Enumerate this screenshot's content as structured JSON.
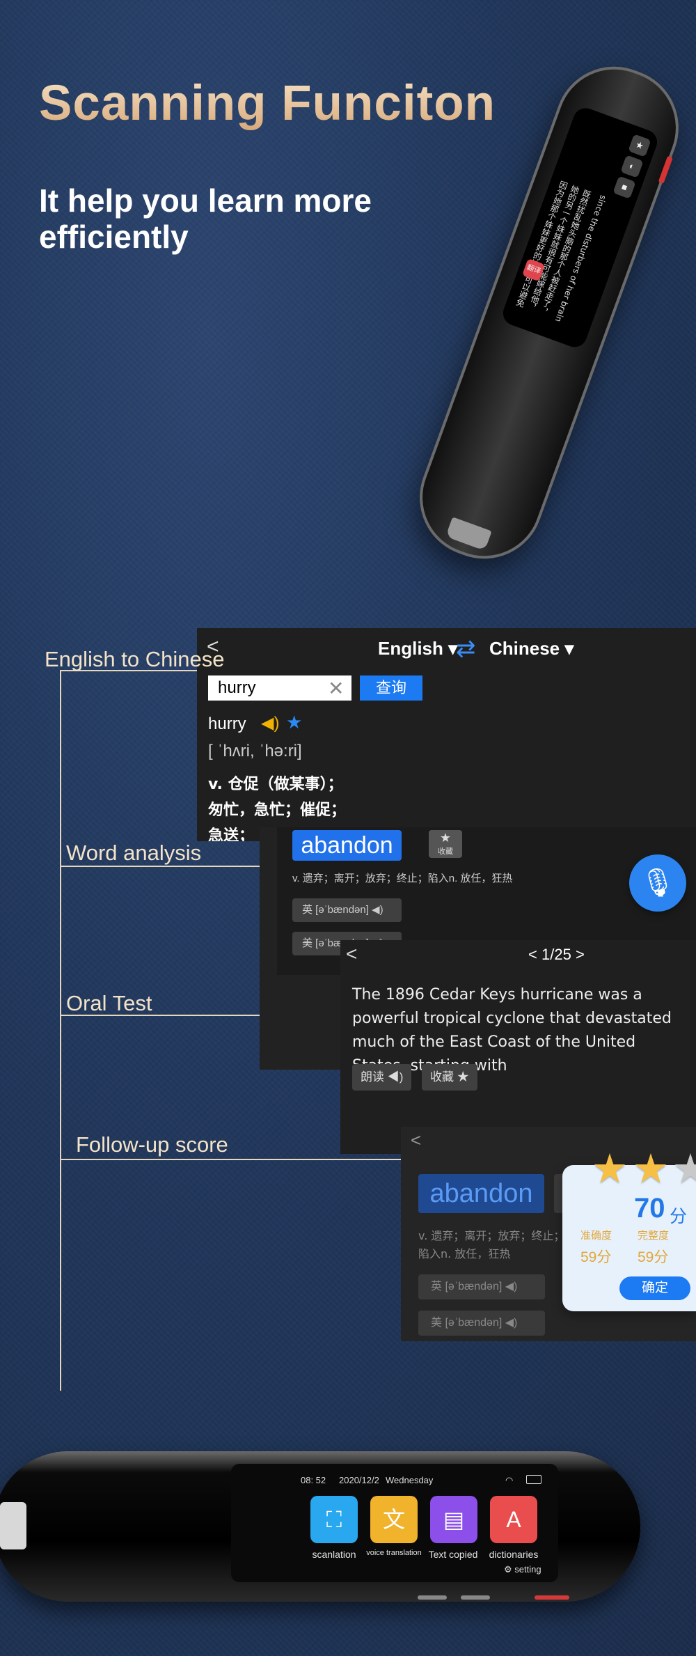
{
  "hero": {
    "title": "Scanning Funciton",
    "subtitle": "It help you learn more efficiently"
  },
  "pen_top": {
    "buttons": [
      "★",
      "◐",
      "■"
    ],
    "text_en": "since the disturbers of her brain",
    "text_cn": "既然扰乱她头脑的那个人被赶走了，她的另一个妹妹就很有可能嫁给他，因为她那个妹妹更好的妹妹可以避免的",
    "red_btn_label": "翻译"
  },
  "labels": {
    "english_to_chinese": "English to Chinese",
    "word_analysis": "Word analysis",
    "oral_test": "Oral Test",
    "follow_up_score": "Follow-up score"
  },
  "panel_translate": {
    "back": "<",
    "lang_from": "English",
    "lang_to": "Chinese",
    "search_value": "hurry",
    "query_button": "查询",
    "word": "hurry",
    "phonetic": "[ ˈhʌri, ˈhə:ri]",
    "definitions": [
      "v. 仓促（做某事）；",
      "匆忙，急忙；催促；",
      "急送；"
    ]
  },
  "panel_word": {
    "word": "abandon",
    "fav_label": "收藏",
    "meaning": "v. 遗弃；离开；放弃；终止；陷入n. 放任，狂热",
    "pron_uk": "英 [əˈbændən]",
    "pron_us": "美 [əˈbændən]"
  },
  "panel_oral": {
    "back": "<",
    "pager": "1/25",
    "paragraph": "The 1896 Cedar Keys hurricane was a powerful tropical cyclone that devastated much of the East Coast of the United States, starting with",
    "read_button": "朗读",
    "fav_button": "收藏"
  },
  "panel_follow": {
    "back": "<",
    "word": "abandon",
    "meaning": "v. 遗弃；离开；放弃；终止；陷入n. 放任，狂热",
    "pron_uk": "英 [əˈbændən]",
    "pron_us": "美 [əˈbændən]"
  },
  "score": {
    "value": "70",
    "unit": "分",
    "accuracy_label": "准确度",
    "accuracy_value": "59分",
    "completeness_label": "完整度",
    "completeness_value": "59分",
    "confirm_button": "确定",
    "stars_shown": 3
  },
  "pen_bottom": {
    "time": "08: 52",
    "date": "2020/12/2",
    "weekday": "Wednesday",
    "apps": [
      {
        "label": "scanlation",
        "icon": "scan-icon",
        "color": "#29a8f0"
      },
      {
        "label": "voice translation",
        "icon": "translate-icon",
        "color": "#f1b22c"
      },
      {
        "label": "Text copied",
        "icon": "text-copy-icon",
        "color": "#8c4fea"
      },
      {
        "label": "dictionaries",
        "icon": "dictionary-icon",
        "color": "#ea4d4d"
      }
    ],
    "setting": "setting"
  },
  "colors": {
    "accent_blue": "#1c7af2",
    "label_cream": "#f3e3c8",
    "score_gold": "#e2a73a"
  }
}
